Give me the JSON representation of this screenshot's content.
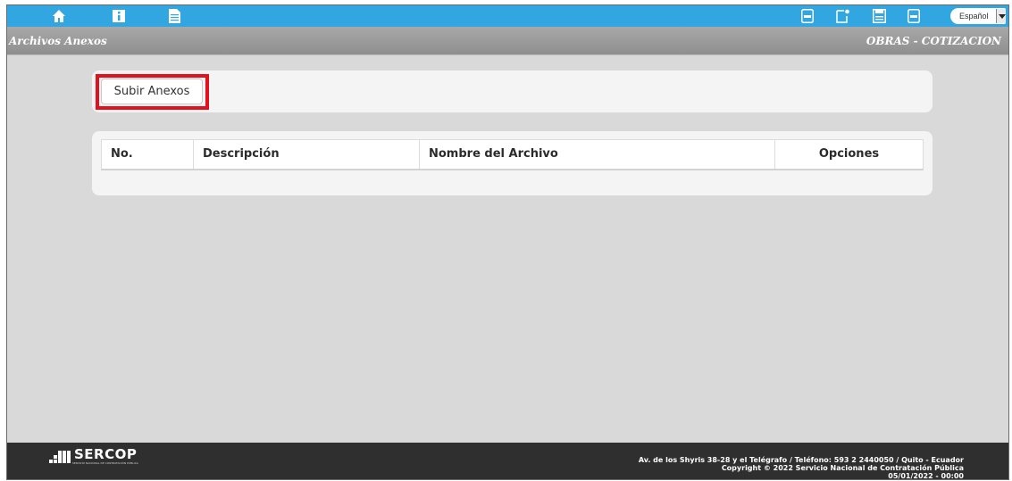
{
  "colors": {
    "topbar": "#32a6e1",
    "titlebar": "#9a9a9a",
    "background": "#d9d9d9",
    "highlight": "#e3101e",
    "footer": "#2f2f2f"
  },
  "topbar": {
    "left_icons": [
      "home-icon",
      "info-icon",
      "document-icon"
    ],
    "right_icons": [
      "pdf-icon",
      "new-document-icon",
      "save-icon",
      "pdf-export-icon"
    ],
    "language": "Español"
  },
  "titlebar": {
    "section": "Archivos Anexos",
    "module": "OBRAS - COTIZACION"
  },
  "upload": {
    "button_label": "Subir Anexos"
  },
  "table": {
    "columns": [
      "No.",
      "Descripción",
      "Nombre del Archivo",
      "Opciones"
    ],
    "rows": []
  },
  "footer": {
    "logo_text": "SERCOP",
    "logo_subtext": "SERVICIO NACIONAL DE CONTRATACIÓN PÚBLICA",
    "address": "Av. de los Shyris 38-28 y el Telégrafo / Teléfono: 593 2 2440050 / Quito - Ecuador",
    "copyright": "Copyright © 2022 Servicio Nacional de Contratación Pública",
    "datetime": "05/01/2022 - 00:00"
  }
}
